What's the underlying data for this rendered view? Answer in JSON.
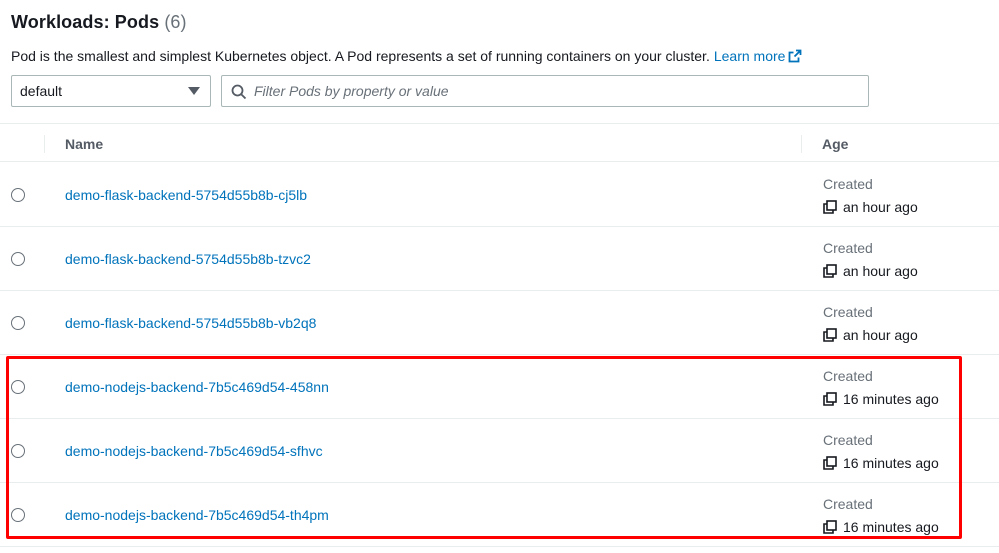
{
  "header": {
    "title": "Workloads: Pods",
    "count": "(6)"
  },
  "description": {
    "text": "Pod is the smallest and simplest Kubernetes object. A Pod represents a set of running containers on your cluster.",
    "link_label": "Learn more"
  },
  "namespace_select": {
    "value": "default"
  },
  "filter": {
    "placeholder": "Filter Pods by property or value"
  },
  "table": {
    "columns": {
      "name": "Name",
      "age": "Age"
    },
    "rows": [
      {
        "name": "demo-flask-backend-5754d55b8b-cj5lb",
        "age_label": "Created",
        "age_value": "an hour ago"
      },
      {
        "name": "demo-flask-backend-5754d55b8b-tzvc2",
        "age_label": "Created",
        "age_value": "an hour ago"
      },
      {
        "name": "demo-flask-backend-5754d55b8b-vb2q8",
        "age_label": "Created",
        "age_value": "an hour ago"
      },
      {
        "name": "demo-nodejs-backend-7b5c469d54-458nn",
        "age_label": "Created",
        "age_value": "16 minutes ago"
      },
      {
        "name": "demo-nodejs-backend-7b5c469d54-sfhvc",
        "age_label": "Created",
        "age_value": "16 minutes ago"
      },
      {
        "name": "demo-nodejs-backend-7b5c469d54-th4pm",
        "age_label": "Created",
        "age_value": "16 minutes ago"
      }
    ]
  },
  "colors": {
    "link": "#0073bb",
    "highlight": "#ff0000",
    "text": "#16191f",
    "muted": "#687078"
  }
}
